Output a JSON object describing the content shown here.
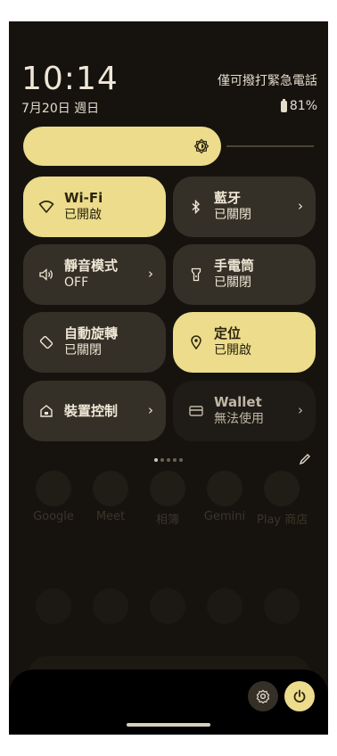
{
  "status": {
    "time": "10:14",
    "date": "7月20日 週日",
    "carrier": "僅可撥打緊急電話",
    "battery": "81%"
  },
  "brightness": {
    "level_percent": 70
  },
  "tiles": [
    {
      "title": "Wi-Fi",
      "state": "已開啟",
      "icon": "wifi-icon",
      "on": true,
      "chevron": false
    },
    {
      "title": "藍牙",
      "state": "已關閉",
      "icon": "bluetooth-icon",
      "on": false,
      "chevron": true
    },
    {
      "title": "靜音模式",
      "state": "OFF",
      "icon": "volume-icon",
      "on": false,
      "chevron": true
    },
    {
      "title": "手電筒",
      "state": "已關閉",
      "icon": "flashlight-icon",
      "on": false,
      "chevron": false
    },
    {
      "title": "自動旋轉",
      "state": "已關閉",
      "icon": "rotate-icon",
      "on": false,
      "chevron": false
    },
    {
      "title": "定位",
      "state": "已開啟",
      "icon": "location-icon",
      "on": true,
      "chevron": false
    },
    {
      "title": "裝置控制",
      "state": "",
      "icon": "home-icon",
      "on": false,
      "chevron": true
    },
    {
      "title": "Wallet",
      "state": "無法使用",
      "icon": "wallet-icon",
      "on": false,
      "chevron": true
    }
  ],
  "pager": {
    "pages": 5,
    "current": 1
  },
  "home_apps": [
    "Google",
    "Meet",
    "相簿",
    "Gemini",
    "Play 商店"
  ],
  "colors": {
    "accent": "#ecdc8b",
    "tile_off": "#353027",
    "background": "#16130f"
  }
}
